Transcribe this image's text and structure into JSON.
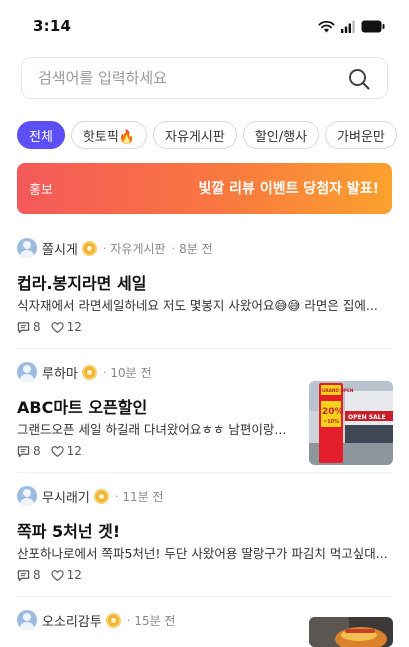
{
  "status_bar": {
    "time": "3:14"
  },
  "search": {
    "placeholder": "검색어를 입력하세요",
    "value": ""
  },
  "categories": [
    {
      "label": "전체",
      "active": true
    },
    {
      "label": "핫토픽🔥",
      "active": false
    },
    {
      "label": "자유게시판",
      "active": false
    },
    {
      "label": "할인/행사",
      "active": false
    },
    {
      "label": "가벼운만",
      "active": false
    }
  ],
  "banner": {
    "tag": "홍보",
    "text": "빛깔 리뷰 이벤트 당첨자 발표!"
  },
  "posts": [
    {
      "author": "쫄시게",
      "board": "자유게시판",
      "time": "8분 전",
      "title": "컵라.봉지라면 세일",
      "body": "식자재에서 라면세일하네요 저도 몇봉지 사왔어요😅😅 라면은 집에...",
      "comments": "8",
      "likes": "12",
      "has_image": false
    },
    {
      "author": "루하마",
      "board": "",
      "time": "10분 전",
      "title": "ABC마트 오픈할인",
      "body": "그랜드오픈 세일 하길래 다녀왔어요ㅎㅎ 남편이랑...",
      "comments": "8",
      "likes": "12",
      "has_image": true,
      "image": {
        "sign_top": "GRAND OPEN",
        "sign_big": "20%",
        "sign_small": "~10%",
        "banner": "OPEN SALE"
      }
    },
    {
      "author": "무시래기",
      "board": "",
      "time": "11분 전",
      "title": "쪽파 5처넌 겟!",
      "body": "산포하나로에서 쪽파5처넌! 두단 사왔어용 딸랑구가 파김치 먹고싶대...",
      "comments": "8",
      "likes": "12",
      "has_image": false
    },
    {
      "author": "오소리감투",
      "board": "",
      "time": "15분 전",
      "title": "",
      "body": "",
      "comments": "",
      "likes": "",
      "has_image": true
    }
  ],
  "colors": {
    "accent": "#5b4ff5",
    "banner_start": "#f4595a",
    "banner_end": "#fba12e",
    "avatar": "#9bbbe0",
    "badge": "#f2b233"
  },
  "icons": {
    "signal": "cellular-signal-icon",
    "wifi": "wifi-icon",
    "battery": "battery-icon",
    "search": "search-icon",
    "comment": "comment-icon",
    "like": "heart-icon",
    "badge": "medal-badge-icon"
  }
}
